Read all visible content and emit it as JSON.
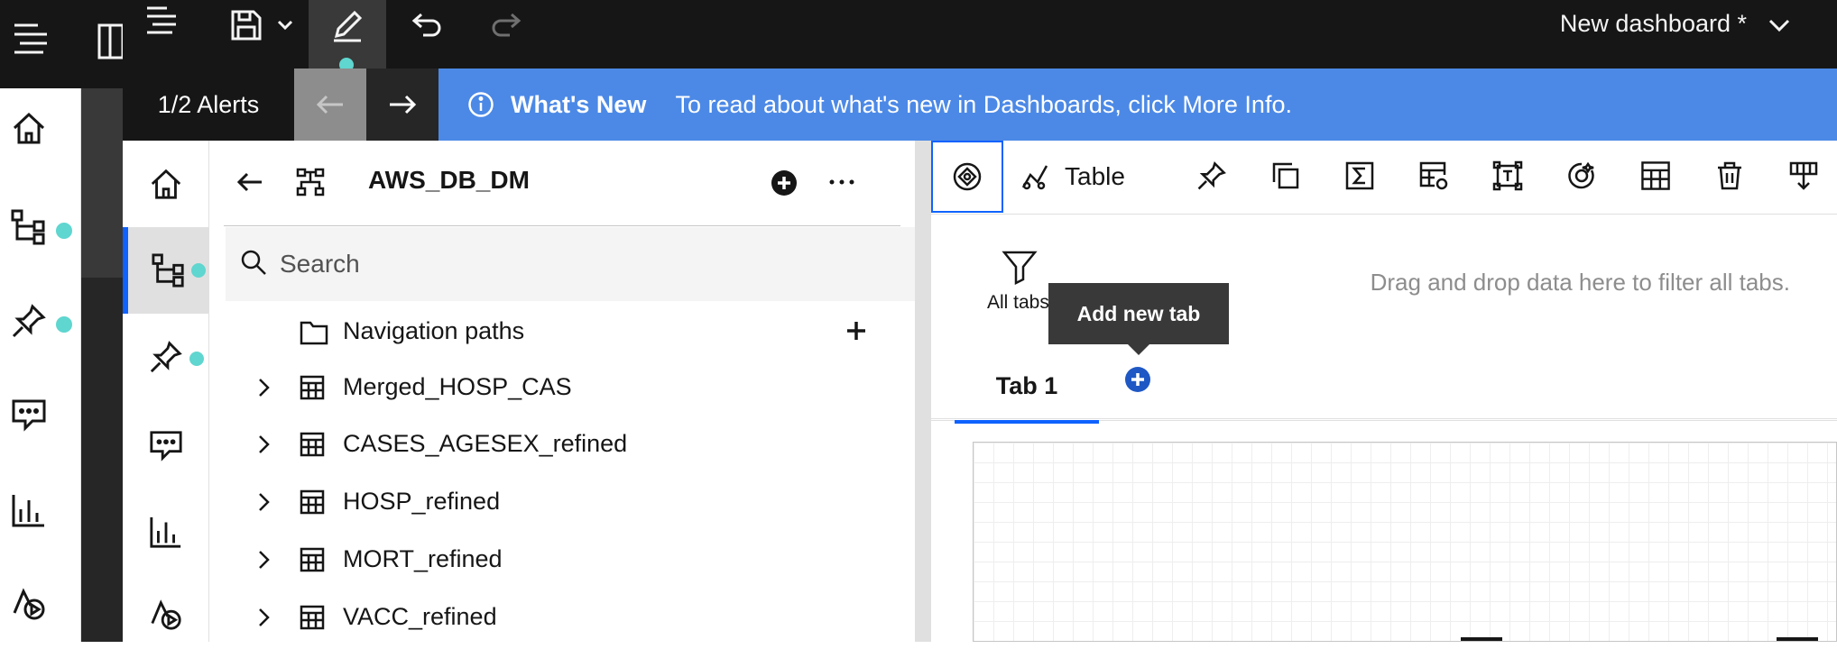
{
  "app": {
    "dashboard_title": "New dashboard *",
    "accent_color": "#0f62fe",
    "alert_color": "#4c89e6",
    "status_dot_color": "#5fd6cf"
  },
  "toolbar": {
    "icons": [
      "menu-icon",
      "save-icon",
      "chevron-down-icon",
      "edit-icon",
      "undo-icon",
      "redo-icon"
    ]
  },
  "alert": {
    "counter": "1/2 Alerts",
    "title": "What's New",
    "message": "To read about what's new in Dashboards, click More Info."
  },
  "rail": {
    "items": [
      "home-icon",
      "data-sources-icon",
      "pin-icon",
      "comment-icon",
      "chart-icon",
      "shapes-icon"
    ]
  },
  "panel": {
    "source_name": "AWS_DB_DM",
    "search_placeholder": "Search",
    "tree": [
      {
        "label": "Navigation paths",
        "type": "folder"
      },
      {
        "label": "Merged_HOSP_CAS",
        "type": "table"
      },
      {
        "label": "CASES_AGESEX_refined",
        "type": "table"
      },
      {
        "label": "HOSP_refined",
        "type": "table"
      },
      {
        "label": "MORT_refined",
        "type": "table"
      },
      {
        "label": "VACC_refined",
        "type": "table"
      }
    ]
  },
  "widget_toolbar": {
    "viz_label": "Table"
  },
  "filters": {
    "all_tabs_label": "All tabs",
    "hint": "Drag and drop data here to filter all tabs."
  },
  "tabs": {
    "items": [
      "Tab 1"
    ],
    "add_tooltip": "Add new tab"
  }
}
